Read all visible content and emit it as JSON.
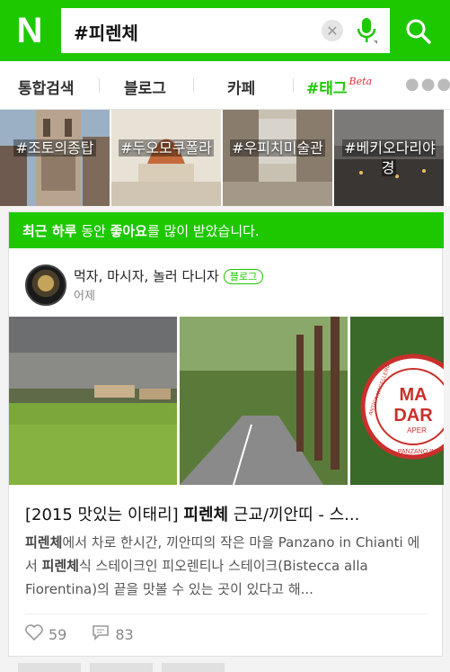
{
  "header": {
    "logo": "N",
    "search_query": "#피렌체",
    "icons": [
      "clear-icon",
      "mic-icon",
      "search-icon"
    ],
    "brand_color": "#1ec800"
  },
  "tabs": [
    {
      "label": "통합검색",
      "active": false
    },
    {
      "label": "블로그",
      "active": false
    },
    {
      "label": "카페",
      "active": false
    },
    {
      "label": "#태그",
      "active": true,
      "badge": "Beta"
    }
  ],
  "thumbnails": [
    {
      "label": "#조토의종탑"
    },
    {
      "label": "#두오모쿠폴라"
    },
    {
      "label": "#우피치미술관"
    },
    {
      "label": "#베키오다리야경"
    }
  ],
  "card": {
    "banner": {
      "part1": "최근 하루",
      "part2": " 동안 ",
      "part3": "좋아요",
      "part4": "를 많이 받았습니다."
    },
    "author": "먹자, 마시자, 놀러 다니자",
    "badge": "블로그",
    "time": "어제",
    "title_prefix": "[2015 맛있는 이태리] ",
    "title_bold": "피렌체",
    "title_suffix": " 근교/끼안띠 - 스...",
    "desc": {
      "b1": "피렌체",
      "t1": "에서 차로 한시간, 끼안띠의 작은 마을 Panzano in Chianti 에서 ",
      "b2": "피렌체",
      "t2": "식 스테이크인 피오렌티나 스테이크(Bistecca alla Fiorentina)의 끝을 맛볼 수 있는 곳이 있다고 해..."
    },
    "likes": "59",
    "comments": "83",
    "sign_text": {
      "top": "MA",
      "mid": "DAR",
      "small": "APER",
      "bottom": "PANZANO IN",
      "side": "ANTICA MACELLERIA"
    }
  }
}
